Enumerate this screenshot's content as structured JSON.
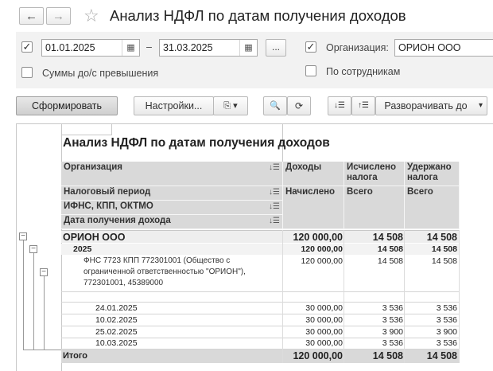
{
  "header": {
    "back_icon": "←",
    "forward_icon": "→",
    "star_icon": "☆",
    "title": "Анализ НДФЛ по датам получения доходов"
  },
  "filters": {
    "period_checked": "✓",
    "date_from": "01.01.2025",
    "dash": "–",
    "date_to": "31.03.2025",
    "calendar_icon": "▦",
    "dots_label": "...",
    "org_checked": "✓",
    "org_label": "Организация:",
    "org_value": "ОРИОН ООО",
    "sums_label": "Суммы до/с превышения",
    "by_employee_label": "По сотрудникам"
  },
  "toolbar": {
    "generate": "Сформировать",
    "settings": "Настройки...",
    "variant_icon": "⎘ ▾",
    "search_icon": "🔍",
    "find_icon": "⟳",
    "sort_asc_icon": "↓☰",
    "sort_desc_icon": "↑☰",
    "expand": "Разворачивать до",
    "dropdown_icon": "▾"
  },
  "report": {
    "title": "Анализ НДФЛ по датам получения доходов",
    "sort_icon": "↓☰",
    "headers": {
      "org": "Организация",
      "period": "Налоговый период",
      "ifns": "ИФНС, КПП, ОКТМО",
      "date": "Дата получения дохода",
      "income": "Доходы",
      "income_sub": "Начислено",
      "calc": "Исчислено налога",
      "calc_sub": "Всего",
      "withheld": "Удержано налога",
      "withheld_sub": "Всего"
    },
    "collapse_icon": "−",
    "org_row": {
      "name": "ОРИОН ООО",
      "income": "120 000,00",
      "calc": "14 508",
      "withheld": "14 508"
    },
    "year_row": {
      "name": "2025",
      "income": "120 000,00",
      "calc": "14 508",
      "withheld": "14 508"
    },
    "fns_row": {
      "line1": "ФНС 7723 КПП 772301001 (Общество с",
      "line2": "ограниченной ответственностью \"ОРИОН\"),",
      "line3": "772301001, 45389000",
      "income": "120 000,00",
      "calc": "14 508",
      "withheld": "14 508"
    },
    "date_rows": [
      {
        "date": "24.01.2025",
        "income": "30 000,00",
        "calc": "3 536",
        "withheld": "3 536"
      },
      {
        "date": "10.02.2025",
        "income": "30 000,00",
        "calc": "3 536",
        "withheld": "3 536"
      },
      {
        "date": "25.02.2025",
        "income": "30 000,00",
        "calc": "3 900",
        "withheld": "3 900"
      },
      {
        "date": "10.03.2025",
        "income": "30 000,00",
        "calc": "3 536",
        "withheld": "3 536"
      }
    ],
    "total_row": {
      "name": "Итого",
      "income": "120 000,00",
      "calc": "14 508",
      "withheld": "14 508"
    }
  }
}
